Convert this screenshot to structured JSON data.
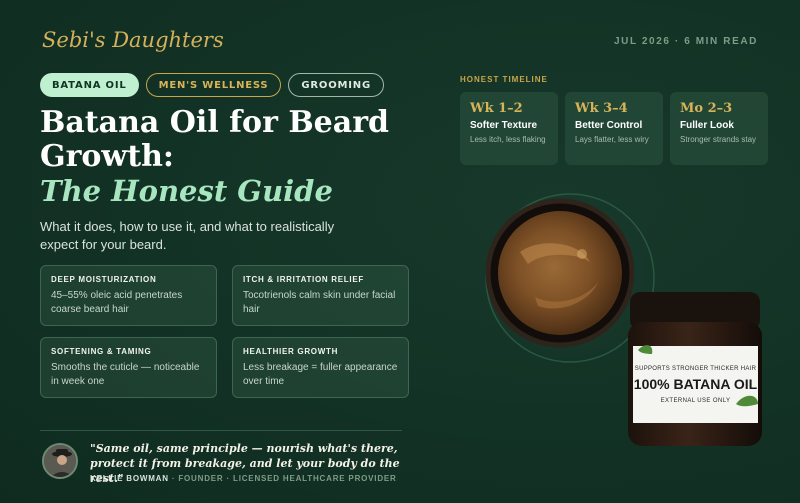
{
  "brand": {
    "name": "Sebi's Daughters"
  },
  "meta": {
    "date_read": "JUL 2026 · 6 MIN READ"
  },
  "tags": [
    "BATANA OIL",
    "MEN'S WELLNESS",
    "GROOMING"
  ],
  "headline": {
    "main": "Batana Oil for Beard Growth:",
    "accent": "The Honest Guide"
  },
  "subtitle": "What it does, how to use it, and what to realistically expect for your beard.",
  "benefits": [
    {
      "title": "DEEP MOISTURIZATION",
      "text": "45–55% oleic acid penetrates coarse beard hair"
    },
    {
      "title": "ITCH & IRRITATION RELIEF",
      "text": "Tocotrienols calm skin under facial hair"
    },
    {
      "title": "SOFTENING & TAMING",
      "text": "Smooths the cuticle — noticeable in week one"
    },
    {
      "title": "HEALTHIER GROWTH",
      "text": "Less breakage = fuller appearance over time"
    }
  ],
  "testimonial": {
    "quote": "\"Same oil, same principle — nourish what's there, protect it from breakage, and let your body do the rest.\"",
    "name": "KELLIE BOWMAN",
    "role": " · FOUNDER · LICENSED HEALTHCARE PROVIDER"
  },
  "timeline": {
    "label": "HONEST TIMELINE",
    "stages": [
      {
        "period": "Wk 1–2",
        "title": "Softer Texture",
        "sub": "Less itch, less flaking"
      },
      {
        "period": "Wk 3–4",
        "title": "Better Control",
        "sub": "Lays flatter, less wiry"
      },
      {
        "period": "Mo 2–3",
        "title": "Fuller Look",
        "sub": "Stronger strands stay"
      }
    ]
  },
  "jar": {
    "top": "SUPPORTS STRONGER THICKER HAIR",
    "main": "100% BATANA OIL",
    "bottom": "EXTERNAL USE ONLY"
  },
  "colors": {
    "background": "#133326",
    "accent_gold": "#d4b15a",
    "accent_mint": "#a7e6bf"
  }
}
